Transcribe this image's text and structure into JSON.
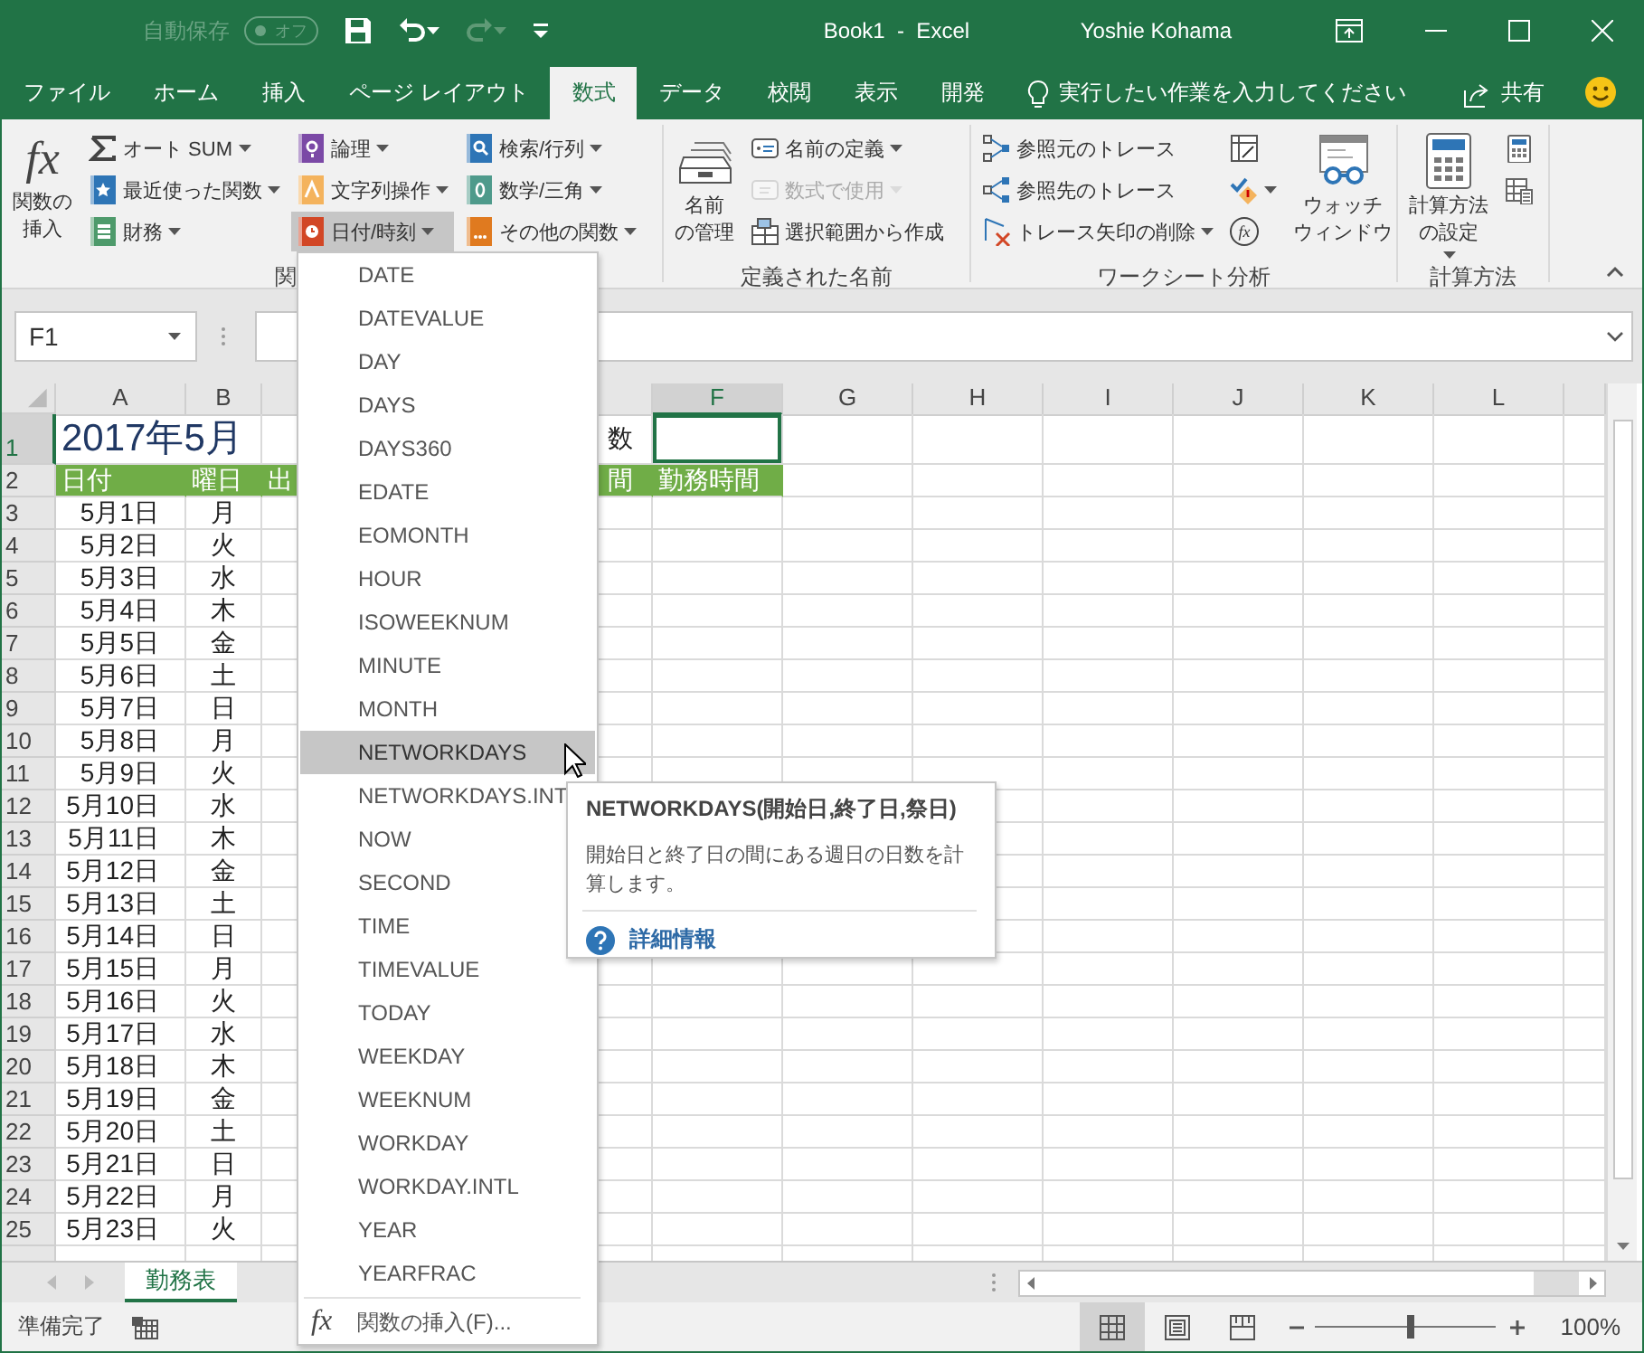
{
  "title_bar": {
    "autosave": {
      "label": "自動保存",
      "state": "オフ",
      "on": false
    },
    "title": "Book1  -  Excel",
    "user": "Yoshie Kohama"
  },
  "ribbon_tabs": [
    {
      "label": "ファイル",
      "selected": false
    },
    {
      "label": "ホーム",
      "selected": false
    },
    {
      "label": "挿入",
      "selected": false
    },
    {
      "label": "ページ レイアウト",
      "selected": false
    },
    {
      "label": "数式",
      "selected": true
    },
    {
      "label": "データ",
      "selected": false
    },
    {
      "label": "校閲",
      "selected": false
    },
    {
      "label": "表示",
      "selected": false
    },
    {
      "label": "開発",
      "selected": false
    }
  ],
  "tell_me": {
    "placeholder": "実行したい作業を入力してください"
  },
  "share": "共有",
  "ribbon": {
    "groups": [
      {
        "label": "関",
        "columns": [
          [
            {
              "kind": "large",
              "glyph": "fx",
              "lines": [
                "関数の",
                "挿入"
              ],
              "dropdown": false,
              "disabled": false,
              "pressed": false
            }
          ],
          [
            {
              "kind": "small",
              "label": "オート SUM",
              "dropdown": true,
              "disabled": false,
              "pressed": false
            },
            {
              "kind": "small",
              "label": "最近使った関数",
              "dropdown": true,
              "disabled": false,
              "pressed": false
            },
            {
              "kind": "small",
              "label": "財務",
              "dropdown": true,
              "disabled": false,
              "pressed": false
            }
          ],
          [
            {
              "kind": "small",
              "label": "論理",
              "dropdown": true,
              "disabled": false,
              "pressed": false
            },
            {
              "kind": "small",
              "label": "文字列操作",
              "dropdown": true,
              "disabled": false,
              "pressed": false
            },
            {
              "kind": "small",
              "label": "日付/時刻",
              "dropdown": true,
              "disabled": false,
              "pressed": true
            }
          ],
          [
            {
              "kind": "small",
              "label": "検索/行列",
              "dropdown": true,
              "disabled": false,
              "pressed": false
            },
            {
              "kind": "small",
              "label": "数学/三角",
              "dropdown": true,
              "disabled": false,
              "pressed": false
            },
            {
              "kind": "small",
              "label": "その他の関数",
              "dropdown": true,
              "disabled": false,
              "pressed": false
            }
          ]
        ]
      },
      {
        "label": "定義された名前",
        "columns": [
          [
            {
              "kind": "large",
              "lines": [
                "名前",
                "の管理"
              ],
              "dropdown": false,
              "disabled": false,
              "pressed": false
            }
          ],
          [
            {
              "kind": "small",
              "label": "名前の定義",
              "dropdown": true,
              "disabled": false,
              "pressed": false
            },
            {
              "kind": "small",
              "label": "数式で使用",
              "dropdown": true,
              "disabled": true,
              "pressed": false
            },
            {
              "kind": "small",
              "label": "選択範囲から作成",
              "dropdown": false,
              "disabled": false,
              "pressed": false
            }
          ]
        ]
      },
      {
        "label": "ワークシート分析",
        "columns": [
          [
            {
              "kind": "small",
              "label": "参照元のトレース",
              "dropdown": false,
              "disabled": false,
              "pressed": false
            },
            {
              "kind": "small",
              "label": "参照先のトレース",
              "dropdown": false,
              "disabled": false,
              "pressed": false
            },
            {
              "kind": "small",
              "label": "トレース矢印の削除",
              "dropdown": true,
              "disabled": false,
              "pressed": false
            }
          ],
          [
            {
              "kind": "icon",
              "dropdown": false,
              "disabled": false,
              "pressed": false
            },
            {
              "kind": "icon",
              "dropdown": true,
              "disabled": false,
              "pressed": false
            },
            {
              "kind": "icon",
              "glyph": "fx",
              "dropdown": false,
              "disabled": false,
              "pressed": false
            }
          ],
          [
            {
              "kind": "large",
              "lines": [
                "ウォッチ",
                "ウィンドウ"
              ],
              "dropdown": false,
              "disabled": false,
              "pressed": false
            }
          ]
        ]
      },
      {
        "label": "計算方法",
        "columns": [
          [
            {
              "kind": "large",
              "lines": [
                "計算方法",
                "の設定"
              ],
              "dropdown": true,
              "disabled": false,
              "pressed": false
            }
          ],
          [
            {
              "kind": "icon",
              "dropdown": false,
              "disabled": false,
              "pressed": false
            },
            {
              "kind": "icon",
              "dropdown": false,
              "disabled": false,
              "pressed": false
            }
          ]
        ]
      }
    ]
  },
  "name_box": {
    "value": "F1"
  },
  "grid": {
    "columns": [
      {
        "label": "A",
        "selected": false
      },
      {
        "label": "B",
        "selected": false
      },
      null,
      null,
      null,
      {
        "label": "F",
        "selected": true
      },
      {
        "label": "G",
        "selected": false
      },
      {
        "label": "H",
        "selected": false
      },
      {
        "label": "I",
        "selected": false
      },
      {
        "label": "J",
        "selected": false
      },
      {
        "label": "K",
        "selected": false
      },
      {
        "label": "L",
        "selected": false
      }
    ],
    "rows": [
      {
        "number": "1",
        "kind": "title",
        "selected": true,
        "cells": [
          "2017年5月",
          null,
          null,
          null,
          "数"
        ]
      },
      {
        "number": "2",
        "kind": "header",
        "selected": false,
        "cells": [
          "日付",
          "曜日",
          "出",
          null,
          "間",
          "勤務時間"
        ]
      },
      {
        "number": "3",
        "kind": "data",
        "selected": false,
        "cells": [
          "5月1日",
          "月"
        ]
      },
      {
        "number": "4",
        "kind": "data",
        "selected": false,
        "cells": [
          "5月2日",
          "火"
        ]
      },
      {
        "number": "5",
        "kind": "data",
        "selected": false,
        "cells": [
          "5月3日",
          "水"
        ]
      },
      {
        "number": "6",
        "kind": "data",
        "selected": false,
        "cells": [
          "5月4日",
          "木"
        ]
      },
      {
        "number": "7",
        "kind": "data",
        "selected": false,
        "cells": [
          "5月5日",
          "金"
        ]
      },
      {
        "number": "8",
        "kind": "data",
        "selected": false,
        "cells": [
          "5月6日",
          "土"
        ]
      },
      {
        "number": "9",
        "kind": "data",
        "selected": false,
        "cells": [
          "5月7日",
          "日"
        ]
      },
      {
        "number": "10",
        "kind": "data",
        "selected": false,
        "cells": [
          "5月8日",
          "月"
        ]
      },
      {
        "number": "11",
        "kind": "data",
        "selected": false,
        "cells": [
          "5月9日",
          "火"
        ]
      },
      {
        "number": "12",
        "kind": "data",
        "selected": false,
        "cells": [
          "5月10日",
          "水"
        ]
      },
      {
        "number": "13",
        "kind": "data",
        "selected": false,
        "cells": [
          "5月11日",
          "木"
        ]
      },
      {
        "number": "14",
        "kind": "data",
        "selected": false,
        "cells": [
          "5月12日",
          "金"
        ]
      },
      {
        "number": "15",
        "kind": "data",
        "selected": false,
        "cells": [
          "5月13日",
          "土"
        ]
      },
      {
        "number": "16",
        "kind": "data",
        "selected": false,
        "cells": [
          "5月14日",
          "日"
        ]
      },
      {
        "number": "17",
        "kind": "data",
        "selected": false,
        "cells": [
          "5月15日",
          "月"
        ]
      },
      {
        "number": "18",
        "kind": "data",
        "selected": false,
        "cells": [
          "5月16日",
          "火"
        ]
      },
      {
        "number": "19",
        "kind": "data",
        "selected": false,
        "cells": [
          "5月17日",
          "水"
        ]
      },
      {
        "number": "20",
        "kind": "data",
        "selected": false,
        "cells": [
          "5月18日",
          "木"
        ]
      },
      {
        "number": "21",
        "kind": "data",
        "selected": false,
        "cells": [
          "5月19日",
          "金"
        ]
      },
      {
        "number": "22",
        "kind": "data",
        "selected": false,
        "cells": [
          "5月20日",
          "土"
        ]
      },
      {
        "number": "23",
        "kind": "data",
        "selected": false,
        "cells": [
          "5月21日",
          "日"
        ]
      },
      {
        "number": "24",
        "kind": "data",
        "selected": false,
        "cells": [
          "5月22日",
          "月"
        ]
      },
      {
        "number": "25",
        "kind": "data",
        "selected": false,
        "cells": [
          "5月23日",
          "火"
        ]
      }
    ]
  },
  "sheet_tabs": [
    {
      "label": "勤務表",
      "selected": true
    }
  ],
  "status_bar": {
    "status": "準備完了",
    "views": [
      {
        "kind": "normal",
        "selected": true
      },
      {
        "kind": "page_layout",
        "selected": false
      },
      {
        "kind": "page_break",
        "selected": false
      }
    ],
    "zoom": {
      "level": 0.53,
      "reading": "100%"
    }
  },
  "function_menu": {
    "items": [
      {
        "label": "DATE",
        "selected": false
      },
      {
        "label": "DATEVALUE",
        "selected": false
      },
      {
        "label": "DAY",
        "selected": false
      },
      {
        "label": "DAYS",
        "selected": false
      },
      {
        "label": "DAYS360",
        "selected": false
      },
      {
        "label": "EDATE",
        "selected": false
      },
      {
        "label": "EOMONTH",
        "selected": false
      },
      {
        "label": "HOUR",
        "selected": false
      },
      {
        "label": "ISOWEEKNUM",
        "selected": false
      },
      {
        "label": "MINUTE",
        "selected": false
      },
      {
        "label": "MONTH",
        "selected": false
      },
      {
        "label": "NETWORKDAYS",
        "selected": true
      },
      {
        "label": "NETWORKDAYS.INT",
        "selected": false
      },
      {
        "label": "NOW",
        "selected": false
      },
      {
        "label": "SECOND",
        "selected": false
      },
      {
        "label": "TIME",
        "selected": false
      },
      {
        "label": "TIMEVALUE",
        "selected": false
      },
      {
        "label": "TODAY",
        "selected": false
      },
      {
        "label": "WEEKDAY",
        "selected": false
      },
      {
        "label": "WEEKNUM",
        "selected": false
      },
      {
        "label": "WORKDAY",
        "selected": false
      },
      {
        "label": "WORKDAY.INTL",
        "selected": false
      },
      {
        "label": "YEAR",
        "selected": false
      },
      {
        "label": "YEARFRAC",
        "selected": false
      }
    ],
    "footer": {
      "glyph": "fx",
      "label": "関数の挿入(F)..."
    }
  },
  "tooltip": {
    "title": "NETWORKDAYS(開始日,終了日,祭日)",
    "description": "開始日と終了日の間にある週日の日数を計算します。",
    "link": "詳細情報"
  }
}
